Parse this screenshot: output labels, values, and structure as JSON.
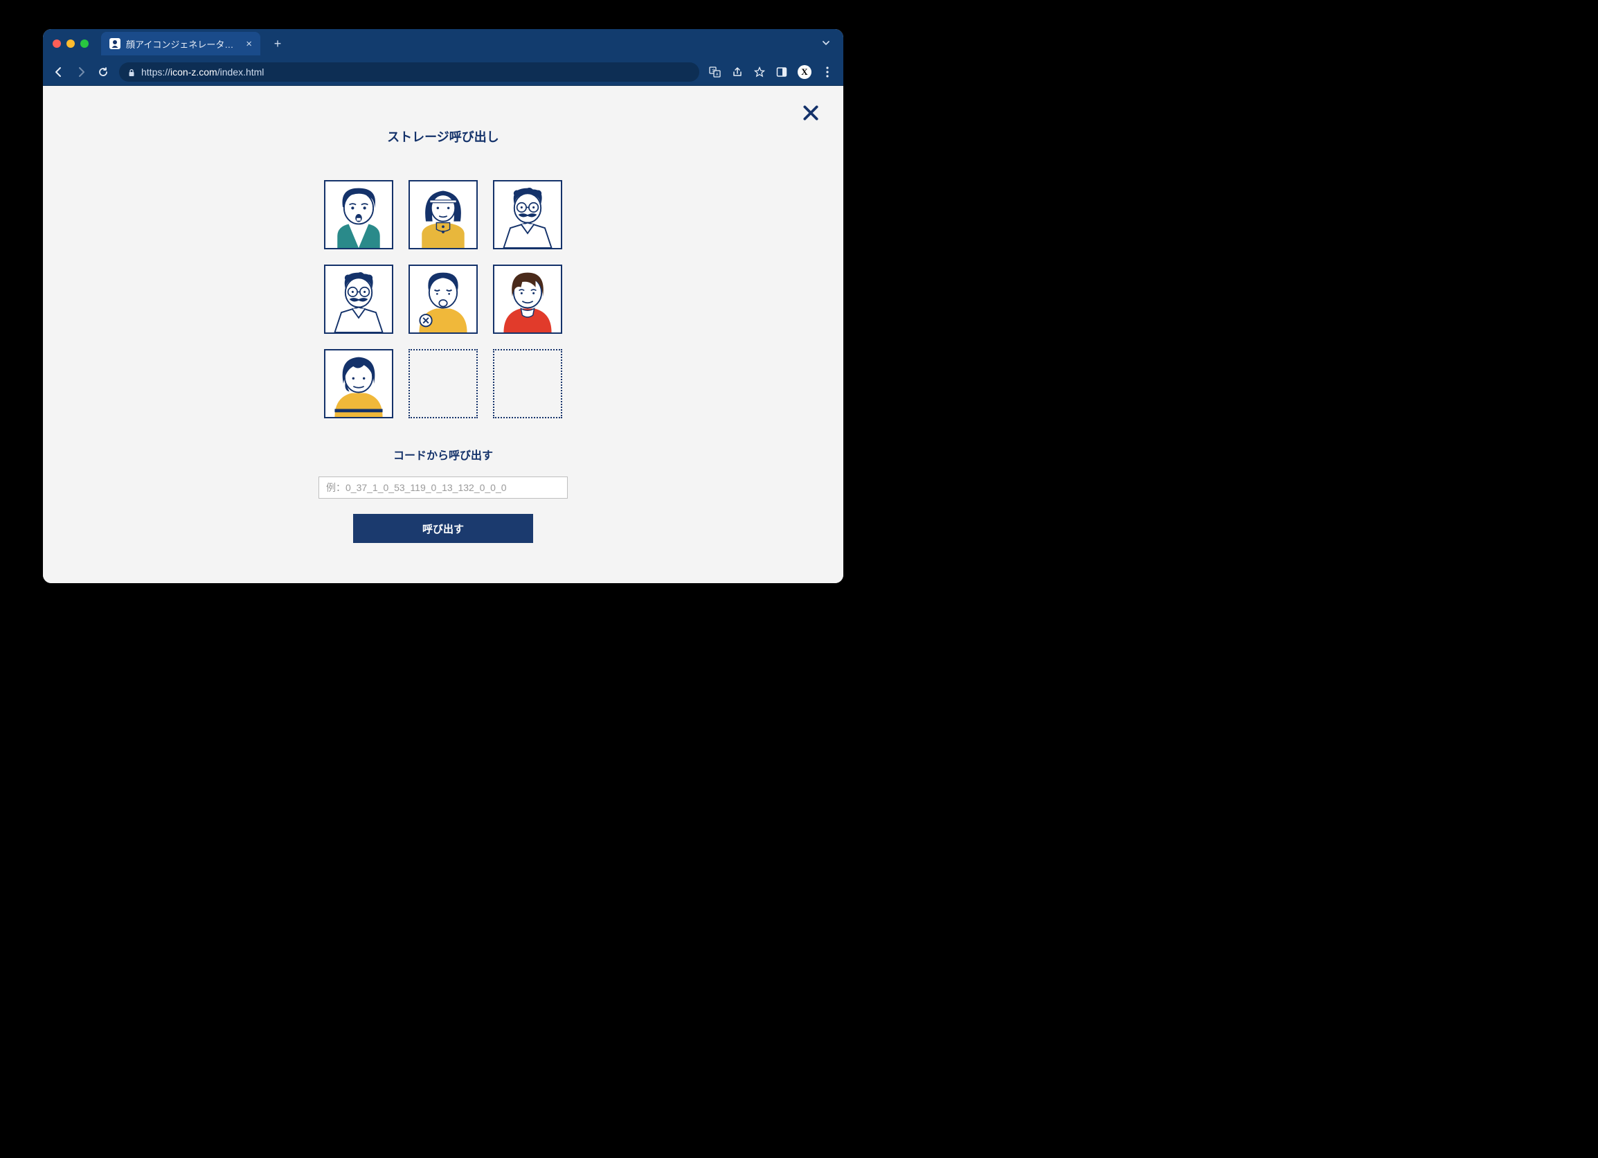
{
  "browser": {
    "tab_title": "顔アイコンジェネレーターZ | 人",
    "url_prefix": "https://",
    "url_domain": "icon-z.com",
    "url_path": "/index.html",
    "profile_letter": "X"
  },
  "modal": {
    "title": "ストレージ呼び出し",
    "subtitle": "コードから呼び出す",
    "placeholder": "例：0_37_1_0_53_119_0_13_132_0_0_0",
    "button": "呼び出す"
  },
  "slots": [
    {
      "filled": true
    },
    {
      "filled": true
    },
    {
      "filled": true
    },
    {
      "filled": true
    },
    {
      "filled": true
    },
    {
      "filled": true
    },
    {
      "filled": true
    },
    {
      "filled": false
    },
    {
      "filled": false
    }
  ],
  "colors": {
    "navy": "#14326a",
    "chrome": "#123c6e",
    "button": "#1b3a6e"
  }
}
